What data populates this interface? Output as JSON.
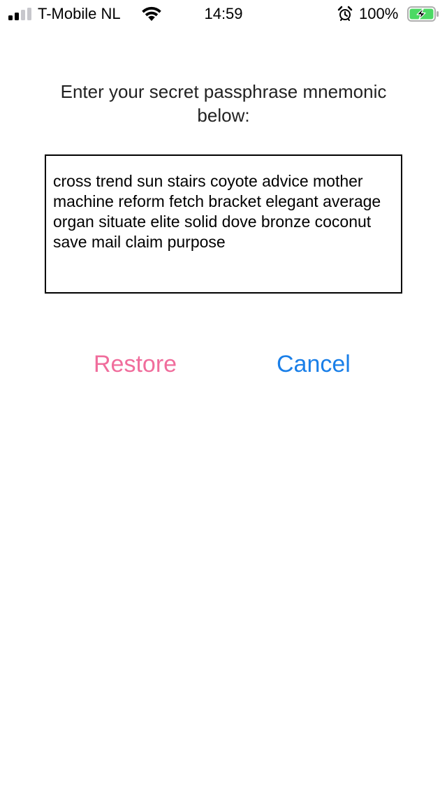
{
  "status_bar": {
    "carrier": "T-Mobile NL",
    "time": "14:59",
    "battery_percent": "100%",
    "signal_bars_active": 2,
    "signal_bars_total": 4,
    "icons": [
      "signal-icon",
      "wifi-icon",
      "alarm-icon",
      "battery-charging-icon"
    ]
  },
  "restore": {
    "instruction": "Enter your secret passphrase mnemonic below:",
    "mnemonic_value": "cross trend sun stairs coyote advice mother machine reform fetch bracket elegant average organ situate elite solid dove bronze coconut save mail claim purpose"
  },
  "actions": {
    "restore_label": "Restore",
    "cancel_label": "Cancel"
  },
  "colors": {
    "restore": "#f06d9c",
    "cancel": "#1a7fe8",
    "battery_fill": "#4cd964",
    "signal_active": "#000000",
    "signal_inactive": "#c7c7cc"
  }
}
